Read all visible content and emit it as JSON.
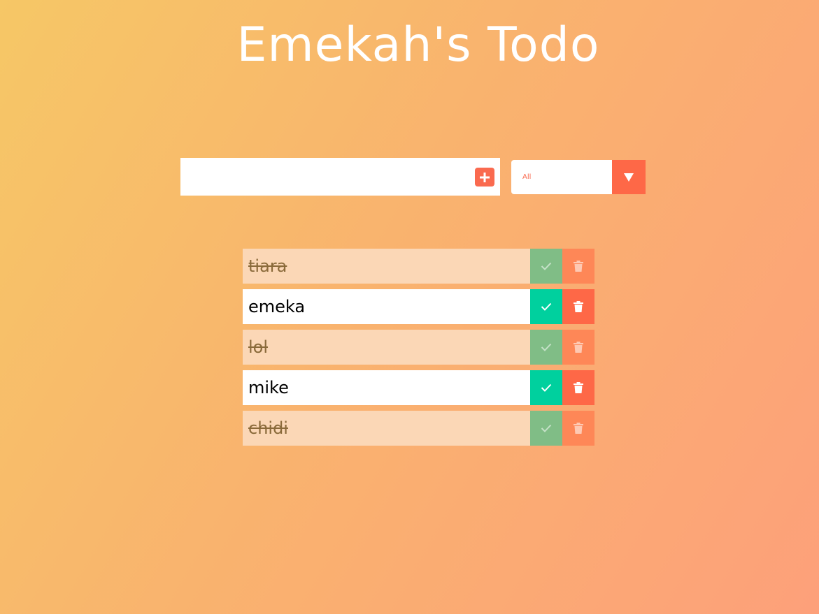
{
  "app": {
    "title": "Emekah's Todo"
  },
  "form": {
    "input_value": "",
    "input_placeholder": "",
    "add_icon": "plus-icon"
  },
  "filter": {
    "selected": "All",
    "arrow_icon": "triangle-down-icon"
  },
  "todos": [
    {
      "text": "tiara",
      "completed": true
    },
    {
      "text": "emeka",
      "completed": false
    },
    {
      "text": "lol",
      "completed": true
    },
    {
      "text": "mike",
      "completed": false
    },
    {
      "text": "chidi",
      "completed": true
    }
  ],
  "colors": {
    "accent": "#fe6847",
    "complete": "#00d09e",
    "completed_row": "#fbd7b6",
    "gradient_start": "#f6c766",
    "gradient_end": "#fda07a"
  }
}
